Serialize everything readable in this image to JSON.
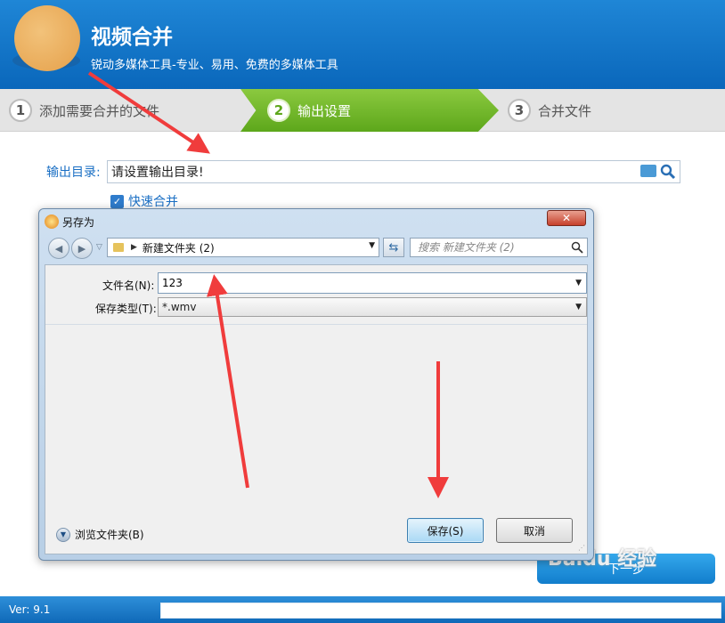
{
  "app": {
    "title": "视频合并",
    "subtitle": "锐动多媒体工具-专业、易用、免费的多媒体工具"
  },
  "steps": [
    {
      "num": "1",
      "label": "添加需要合并的文件"
    },
    {
      "num": "2",
      "label": "输出设置"
    },
    {
      "num": "3",
      "label": "合并文件"
    }
  ],
  "output": {
    "label": "输出目录:",
    "value": "请设置输出目录!",
    "fast_merge_label": "快速合并",
    "fast_merge_checked": true
  },
  "dialog": {
    "title": "另存为",
    "close_symbol": "✕",
    "nav": {
      "path": "新建文件夹 (2)",
      "search_placeholder": "搜索 新建文件夹 (2)"
    },
    "filename_label": "文件名(N):",
    "filename_value": "123",
    "filetype_label": "保存类型(T):",
    "filetype_value": "*.wmv",
    "browse_label": "浏览文件夹(B)",
    "save_label": "保存(S)",
    "cancel_label": "取消"
  },
  "footer": {
    "version": "Ver: 9.1",
    "next_label": "下一步"
  },
  "watermark": "Baidu 经验",
  "colors": {
    "header_blue": "#0a67bb",
    "step_active_green": "#5da71b",
    "annotation_red": "#f03c3c"
  }
}
